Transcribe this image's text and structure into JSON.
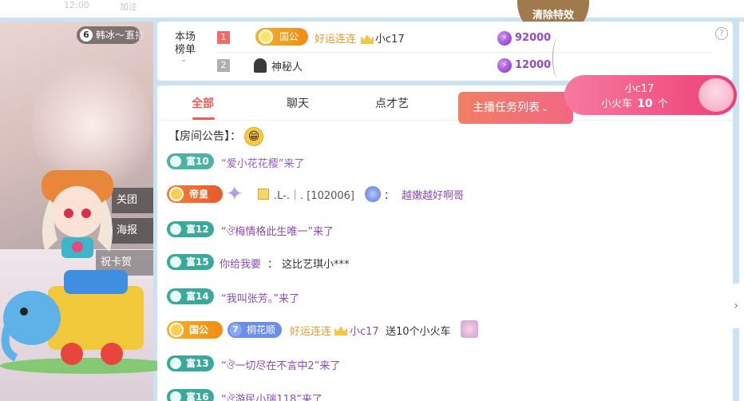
{
  "top": {
    "time": "12:00",
    "ghost": "加注"
  },
  "video": {
    "tag": "韩冰～下",
    "tag_right": "直播",
    "side_buttons": [
      "关团",
      "海报",
      "祝卡贺"
    ]
  },
  "clear_effects": "清除特效",
  "board": {
    "label_line1": "本场",
    "label_line2": "榜单",
    "rows": [
      {
        "rank": "1",
        "badge": "国公",
        "prefix": "好运连连",
        "name": "小c17",
        "amount": "92000",
        "rank_color": "#f26a6a"
      },
      {
        "rank": "2",
        "badge": "",
        "prefix": "",
        "name": "神秘人",
        "amount": "12000",
        "rank_color": "#b0b0b0"
      }
    ],
    "help": "?"
  },
  "banner": {
    "user": "小c17",
    "gift_prefix": "小火车",
    "gift_count": "10",
    "gift_unit": "个"
  },
  "tabs": [
    {
      "label": "全部",
      "active": true
    },
    {
      "label": "聊天",
      "active": false
    },
    {
      "label": "点才艺",
      "active": false
    }
  ],
  "task_button": "主播任务列表",
  "notice": {
    "label": "【房间公告】："
  },
  "messages": [
    {
      "level": "富10",
      "text": "“爱小花花樱”来了"
    },
    {
      "badge": "帝皇",
      "name": ".L-.｜. [102006]",
      "sep": "：",
      "text": "越嫩越好啊哥"
    },
    {
      "level": "富12",
      "text": "“ঔ梅情格此生唯一”来了"
    },
    {
      "level": "富15",
      "name": "你给我要",
      "sep": "：",
      "text": "这比艺琪小***"
    },
    {
      "level": "富14",
      "text": "“我叫张芳。”来了"
    },
    {
      "badge": "国公",
      "petal_level": "7",
      "petal_name": "桐花顺",
      "prefix": "好运连连",
      "name": "小c17",
      "text": "送10个小火车"
    },
    {
      "level": "富13",
      "text": "“ঔ一切尽在不言中2”来了"
    },
    {
      "level": "富16",
      "text": "“ঔ游民小瑞118”来了"
    }
  ],
  "scroll_arrow": "›"
}
